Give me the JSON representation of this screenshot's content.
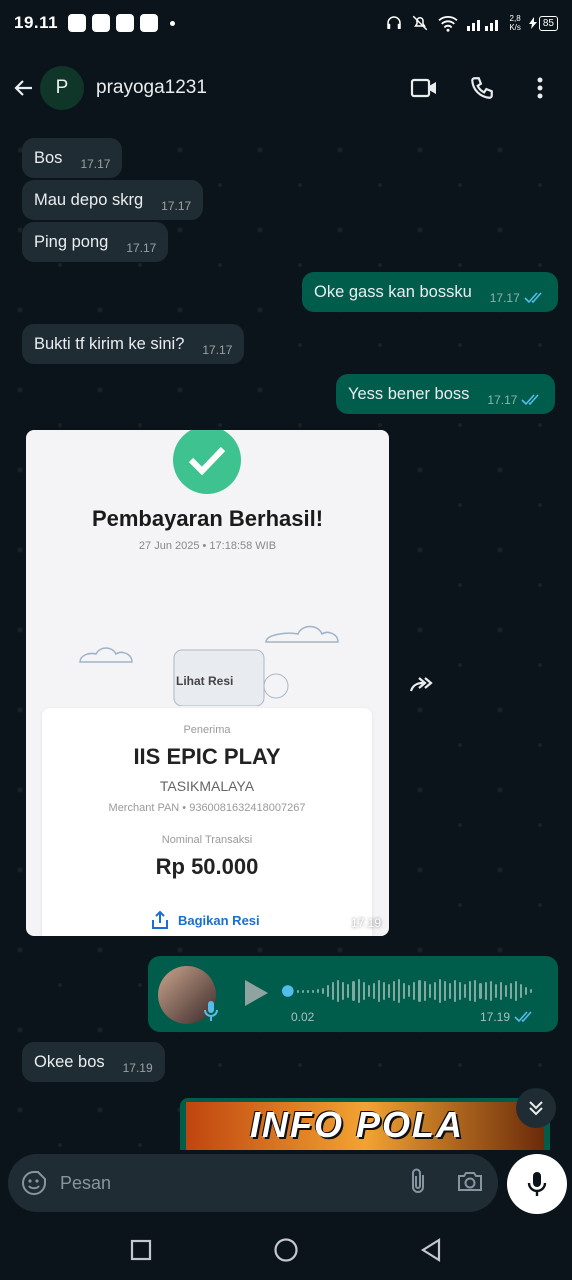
{
  "status_bar": {
    "time": "19.11",
    "network_speed": "2,8",
    "network_unit": "K/s",
    "battery": "85"
  },
  "header": {
    "avatar_initial": "P",
    "contact_name": "prayoga1231"
  },
  "messages": [
    {
      "dir": "in",
      "text": "Bos",
      "time": "17.17"
    },
    {
      "dir": "in",
      "text": "Mau depo skrg",
      "time": "17.17"
    },
    {
      "dir": "in",
      "text": "Ping pong",
      "time": "17.17"
    },
    {
      "dir": "out",
      "text": "Oke gass kan bossku",
      "time": "17.17"
    },
    {
      "dir": "in",
      "text": "Bukti tf kirim ke sini?",
      "time": "17.17"
    },
    {
      "dir": "out",
      "text": "Yess bener boss",
      "time": "17.17"
    }
  ],
  "receipt": {
    "title": "Pembayaran Berhasil!",
    "date": "27 Jun 2025 • 17:18:58 WIB",
    "view_receipt": "Lihat Resi",
    "recipient_label": "Penerima",
    "merchant": "IIS EPIC PLAY",
    "city": "TASIKMALAYA",
    "merchant_pan": "Merchant PAN • 9360081632418007267",
    "amount_label": "Nominal Transaksi",
    "amount": "Rp 50.000",
    "share": "Bagikan Resi",
    "time": "17.19"
  },
  "voice": {
    "duration": "0.02",
    "time": "17.19"
  },
  "last_in": {
    "text": "Okee bos",
    "time": "17.19"
  },
  "banner": {
    "text": "INFO POLA"
  },
  "input": {
    "placeholder": "Pesan"
  },
  "colors": {
    "incoming": "#202c33",
    "outgoing": "#005c4b",
    "background": "#0b141a",
    "read_ticks": "#53bdeb",
    "success": "#3ec28f"
  },
  "icons": [
    "back-arrow-icon",
    "video-call-icon",
    "phone-icon",
    "more-vert-icon",
    "forward-icon",
    "play-icon",
    "mic-icon",
    "chevron-double-down-icon",
    "emoji-icon",
    "attach-icon",
    "camera-icon",
    "nav-square-icon",
    "nav-circle-icon",
    "nav-back-icon"
  ]
}
